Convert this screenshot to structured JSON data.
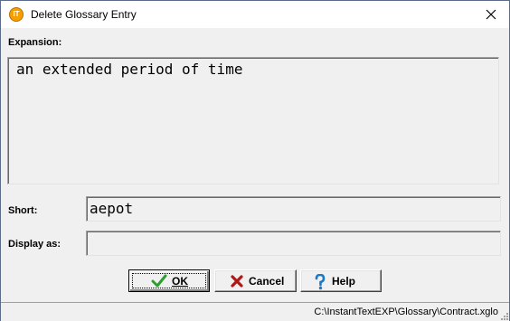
{
  "window": {
    "title": "Delete Glossary Entry",
    "app_icon_text": "IT",
    "icons": {
      "app": "instanttext-app-icon",
      "close": "close-icon"
    }
  },
  "form": {
    "expansion_label": "Expansion:",
    "expansion_value": "an extended period of time",
    "short_label": "Short:",
    "short_value": "aepot",
    "display_label": "Display as:",
    "display_value": ""
  },
  "buttons": {
    "ok": {
      "label": "OK",
      "icon": "green-checkmark-icon"
    },
    "cancel": {
      "label": "Cancel",
      "icon": "red-x-icon"
    },
    "help": {
      "label": "Help",
      "icon": "question-mark-icon"
    }
  },
  "status": {
    "path": "C:\\InstantTextEXP\\Glossary\\Contract.xglo"
  },
  "colors": {
    "accent_check": "#2f9e2f",
    "accent_cancel": "#b01818",
    "accent_help": "#1c78c8",
    "app_icon": "#f5a000"
  }
}
